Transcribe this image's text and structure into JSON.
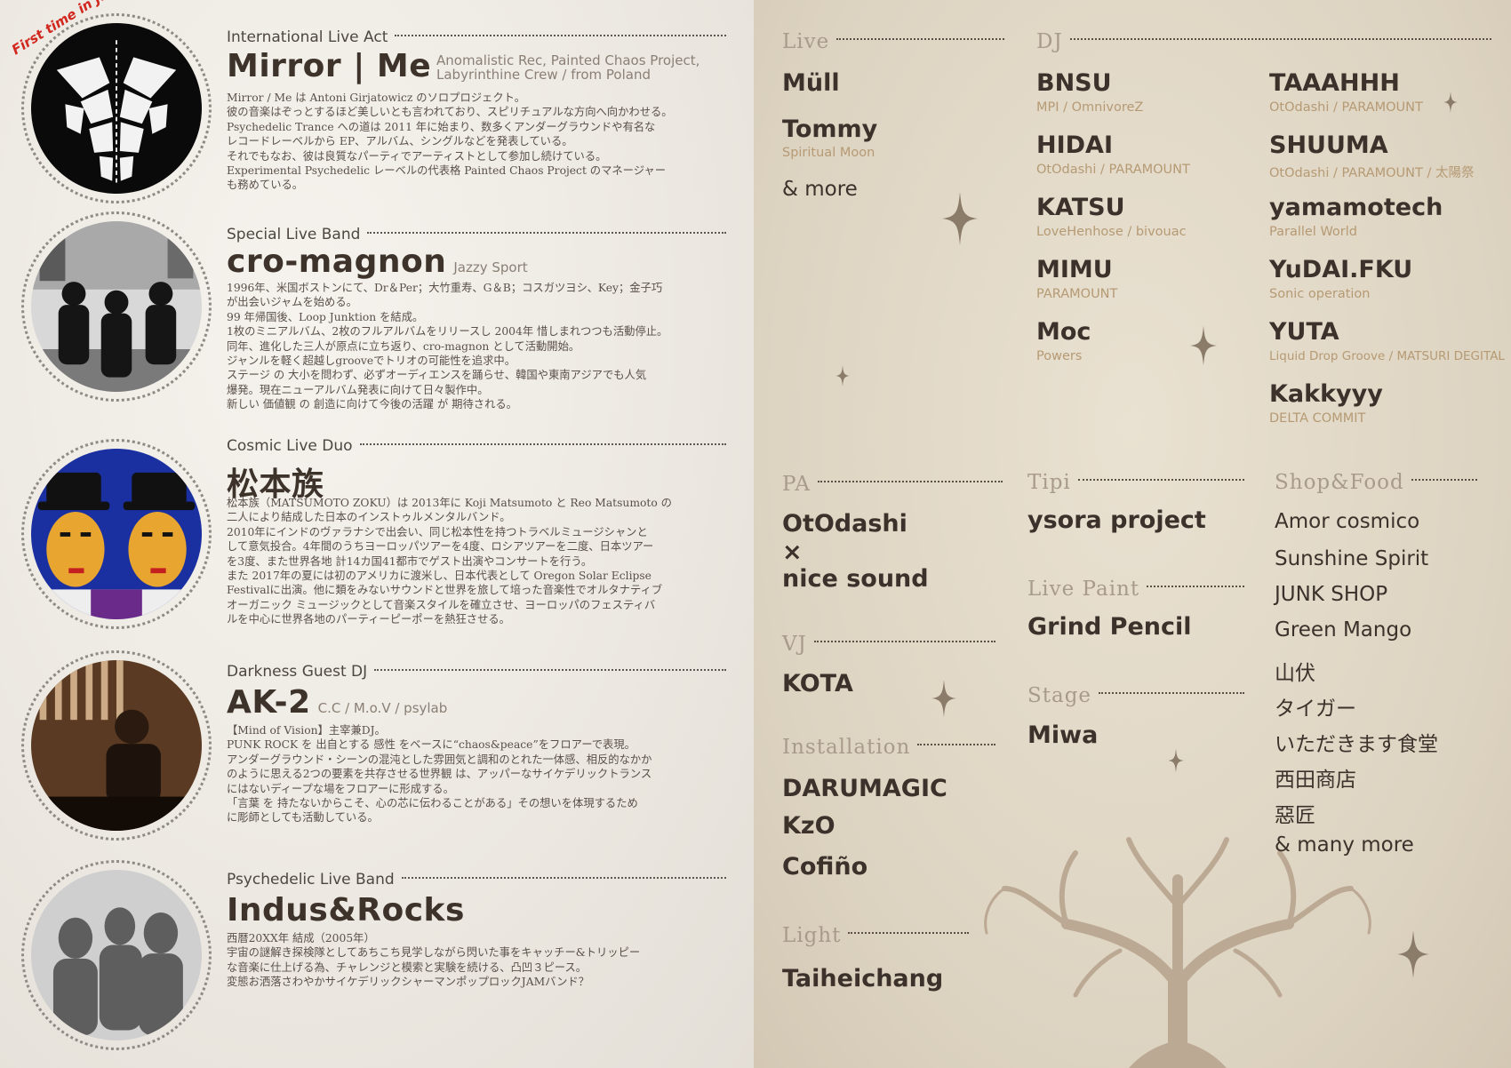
{
  "left": {
    "first_time_badge": "First time in Japan!!!",
    "acts": [
      {
        "label": "International Live Act",
        "name": "Mirror | Me",
        "sub_lines": [
          "Anomalistic Rec, Painted Chaos Project,",
          "Labyrinthine Crew / from Poland"
        ],
        "desc": [
          "Mirror / Me は Antoni Girjatowicz のソロプロジェクト。",
          "彼の音楽はぞっとするほど美しいとも言われており、スピリチュアルな方向へ向かわせる。",
          "Psychedelic Trance への道は 2011 年に始まり、数多くアンダーグラウンドや有名な",
          "レコードレーベルから EP、アルバム、シングルなどを発表している。",
          "それでもなお、彼は良質なパーティでアーティストとして参加し続けている。",
          "Experimental Psychedelic レーベルの代表格 Painted Chaos Project のマネージャー",
          "も務めている。"
        ]
      },
      {
        "label": "Special Live Band",
        "name": "cro-magnon",
        "sub": "Jazzy Sport",
        "desc": [
          "1996年、米国ボストンにて、Dr＆Per；大竹重寿、G＆B；コスガツヨシ、Key；金子巧",
          "が出会いジャムを始める。",
          "99 年帰国後、Loop Junktion を結成。",
          "1枚のミニアルバム、2枚のフルアルバムをリリースし 2004年 惜しまれつつも活動停止。",
          "同年、進化した三人が原点に立ち返り、cro-magnon として活動開始。",
          "ジャンルを軽く超越しgrooveでトリオの可能性を追求中。",
          "ステージ の 大小を問わず、必ずオーディエンスを踊らせ、韓国や東南アジアでも人気",
          "爆発。現在ニューアルバム発表に向けて日々製作中。",
          "新しい 価値観 の 創造に向けて今後の活躍 が 期待される。"
        ]
      },
      {
        "label": "Cosmic Live Duo",
        "name": "松本族",
        "desc": [
          "松本族（MATSUMOTO ZOKU）は 2013年に Koji Matsumoto と Reo Matsumoto の",
          "二人により結成した日本のインストゥルメンタルバンド。",
          "2010年にインドのヴァラナシで出会い、同じ松本性を持つトラベルミュージシャンと",
          "して意気投合。4年間のうちヨーロッパツアーを4度、ロシアツアーを二度、日本ツアー",
          "を3度、また世界各地 計14カ国41都市でゲスト出演やコンサートを行う。",
          "また 2017年の夏には初のアメリカに渡米し、日本代表として Oregon Solar Eclipse",
          "Festivalに出演。他に類をみないサウンドと世界を旅して培った音楽性でオルタナティブ",
          "オーガニック ミュージックとして音楽スタイルを確立させ、ヨーロッパのフェスティバ",
          "ルを中心に世界各地のパーティーピーポーを熱狂させる。"
        ]
      },
      {
        "label": "Darkness Guest DJ",
        "name": "AK-2",
        "sub": "C.C / M.o.V / psylab",
        "desc": [
          "【Mind of Vision】主宰兼DJ。",
          "PUNK ROCK を 出自とする 感性 をベースに“chaos&peace”をフロアーで表現。",
          "アンダーグラウンド・シーンの混沌とした雰囲気と調和のとれた一体感、相反的なかか",
          "のように思える2つの要素を共存させる世界観 は、アッパーなサイケデリックトランス",
          "にはないディープな場をフロアーに形成する。",
          "「言葉 を 持たないからこそ、心の芯に伝わることがある」その想いを体現するため",
          "に彫師としても活動している。"
        ]
      },
      {
        "label": "Psychedelic Live Band",
        "name": "Indus&Rocks",
        "desc": [
          "西暦20XX年 結成（2005年）",
          "宇宙の謎解き探検隊としてあちこち見学しながら閃いた事をキャッチー&トリッピー",
          "な音楽に仕上げる為、チャレンジと模索と実験を続ける、凸凹３ピース。",
          "変態お洒落さわやかサイケデリックシャーマンポップロックJAMバンド？"
        ]
      }
    ]
  },
  "right": {
    "live": {
      "heading": "Live",
      "items": [
        "Müll",
        "Tommy",
        "& more"
      ],
      "tommy_aff": "Spiritual Moon"
    },
    "dj": {
      "heading": "DJ",
      "col1": [
        {
          "name": "BNSU",
          "aff": "MPI / OmnivoreZ"
        },
        {
          "name": "HIDAI",
          "aff": "OtOdashi / PARAMOUNT"
        },
        {
          "name": "KATSU",
          "aff": "LoveHenhose / bivouac"
        },
        {
          "name": "MIMU",
          "aff": "PARAMOUNT"
        },
        {
          "name": "Moc",
          "aff": "Powers"
        }
      ],
      "col2": [
        {
          "name": "TAAAHHH",
          "aff": "OtOdashi / PARAMOUNT"
        },
        {
          "name": "SHUUMA",
          "aff": "OtOdashi / PARAMOUNT / 太陽祭"
        },
        {
          "name": "yamamotech",
          "aff": "Parallel World"
        },
        {
          "name": "YuDAI.FKU",
          "aff": "Sonic operation"
        },
        {
          "name": "YUTA",
          "aff": "Liquid Drop Groove / MATSURI DEGITAL"
        },
        {
          "name": "Kakkyyy",
          "aff": "DELTA COMMIT"
        }
      ]
    },
    "pa": {
      "heading": "PA",
      "lines": [
        "OtOdashi",
        "×",
        "nice sound"
      ]
    },
    "vj": {
      "heading": "VJ",
      "items": [
        "KOTA"
      ]
    },
    "installation": {
      "heading": "Installation",
      "items": [
        "DARUMAGIC",
        "KzO",
        "Cofiño"
      ]
    },
    "light": {
      "heading": "Light",
      "items": [
        "Taiheichang"
      ]
    },
    "tipi": {
      "heading": "Tipi",
      "items": [
        "ysora project"
      ]
    },
    "live_paint": {
      "heading": "Live Paint",
      "items": [
        "Grind Pencil"
      ]
    },
    "stage": {
      "heading": "Stage",
      "items": [
        "Miwa"
      ]
    },
    "shop_food": {
      "heading": "Shop&Food",
      "items": [
        "Amor cosmico",
        "Sunshine Spirit",
        "JUNK SHOP",
        "Green Mango",
        "山伏",
        "タイガー",
        "いただきます食堂",
        "西田商店",
        "惡匠",
        "& many more"
      ]
    }
  },
  "icons": [
    "sparkle-icon",
    "tree-of-life-icon"
  ],
  "colors": {
    "accent_red": "#d0281f",
    "affiliation": "#b59a74",
    "heading_muted": "#a89b8b"
  }
}
